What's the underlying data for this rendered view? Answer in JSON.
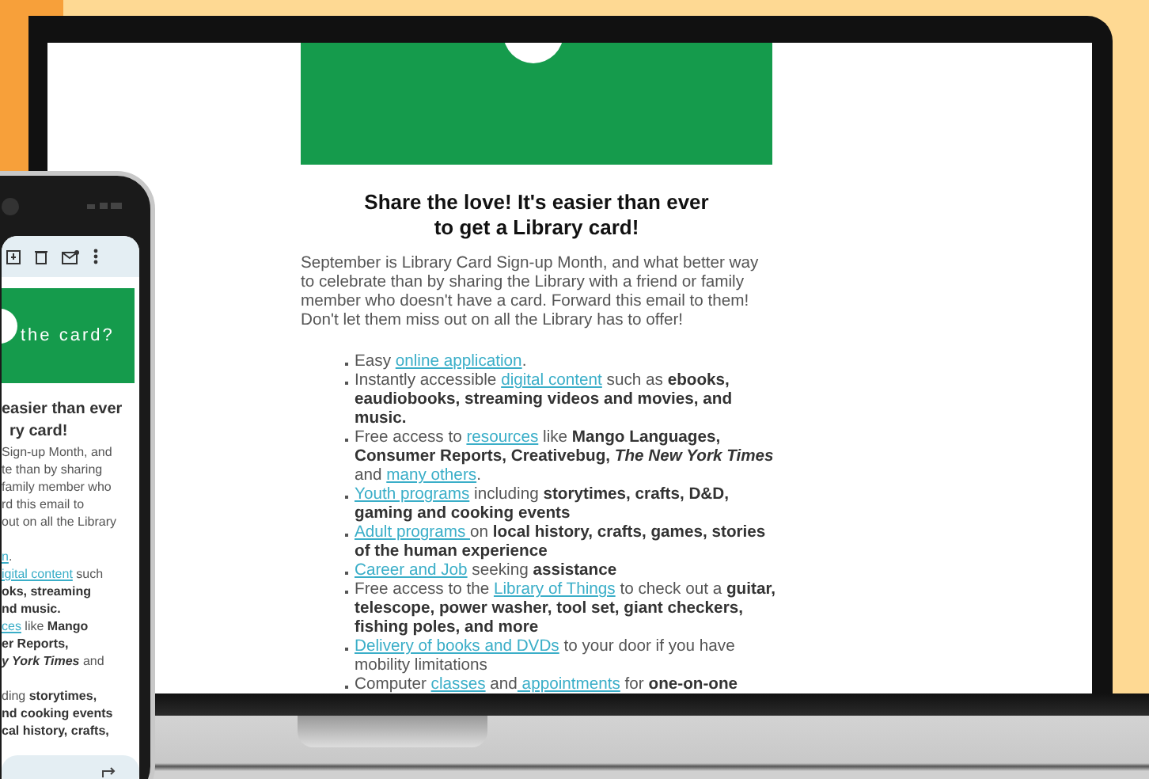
{
  "laptop": {
    "email": {
      "heading": [
        "Share the love! It's easier than ever",
        "to get a Library card!"
      ],
      "intro": "September is Library Card Sign-up Month, and what better way to celebrate than by sharing the Library with a friend or family member who doesn't have a card. Forward this email to them! Don't let them miss out on all the Library has to offer!",
      "items": [
        [
          {
            "kind": "text",
            "text": "Easy "
          },
          {
            "kind": "link",
            "text": "online application"
          },
          {
            "kind": "text",
            "text": "."
          }
        ],
        [
          {
            "kind": "text",
            "text": "Instantly accessible "
          },
          {
            "kind": "link",
            "text": "digital content"
          },
          {
            "kind": "text",
            "text": " such as "
          },
          {
            "kind": "bold",
            "text": "ebooks, eaudiobooks, streaming videos and movies, and music."
          }
        ],
        [
          {
            "kind": "text",
            "text": "Free access to "
          },
          {
            "kind": "link",
            "text": "resources"
          },
          {
            "kind": "text",
            "text": " like "
          },
          {
            "kind": "bold",
            "text": "Mango Languages, Consumer Reports, Creativebug, "
          },
          {
            "kind": "bold_italic",
            "text": "The New York Times"
          },
          {
            "kind": "text",
            "text": " and "
          },
          {
            "kind": "link",
            "text": "many others"
          },
          {
            "kind": "text",
            "text": "."
          }
        ],
        [
          {
            "kind": "link",
            "text": "Youth programs"
          },
          {
            "kind": "text",
            "text": " including "
          },
          {
            "kind": "bold",
            "text": "storytimes, crafts, D&D, gaming and cooking events"
          }
        ],
        [
          {
            "kind": "link",
            "text": "Adult programs "
          },
          {
            "kind": "text",
            "text": "on "
          },
          {
            "kind": "bold",
            "text": "local history, crafts, games, stories of the human experience"
          }
        ],
        [
          {
            "kind": "link",
            "text": "Career and Job"
          },
          {
            "kind": "text",
            "text": " seeking "
          },
          {
            "kind": "bold",
            "text": "assistance"
          }
        ],
        [
          {
            "kind": "text",
            "text": "Free access to the "
          },
          {
            "kind": "link",
            "text": "Library of Things"
          },
          {
            "kind": "text",
            "text": " to check out a "
          },
          {
            "kind": "bold",
            "text": "guitar, telescope, power washer, tool set, giant checkers, fishing poles, and more"
          }
        ],
        [
          {
            "kind": "link",
            "text": "Delivery of books and DVDs"
          },
          {
            "kind": "text",
            "text": " to your door if you have mobility limitations"
          }
        ],
        [
          {
            "kind": "text",
            "text": "Computer "
          },
          {
            "kind": "link",
            "text": "classes"
          },
          {
            "kind": "text",
            "text": " and"
          },
          {
            "kind": "link",
            "text": " appointments"
          },
          {
            "kind": "text",
            "text": " for "
          },
          {
            "kind": "bold",
            "text": "one-on-one"
          }
        ]
      ]
    }
  },
  "phone": {
    "banner_text": "the card?",
    "lines": [
      [
        {
          "kind": "heading",
          "text": "easier than ever"
        }
      ],
      [
        {
          "kind": "heading",
          "text": "ry card!"
        }
      ],
      [
        {
          "kind": "text",
          "text": "Sign-up Month, and"
        }
      ],
      [
        {
          "kind": "text",
          "text": "te than by sharing"
        }
      ],
      [
        {
          "kind": "text",
          "text": "family member who"
        }
      ],
      [
        {
          "kind": "text",
          "text": "rd this email to"
        }
      ],
      [
        {
          "kind": "text",
          "text": "out on all the Library"
        }
      ],
      [
        {
          "kind": "link",
          "text": "n",
          "gap_before": true
        },
        {
          "kind": "text",
          "text": "."
        }
      ],
      [
        {
          "kind": "link",
          "text": "igital content"
        },
        {
          "kind": "text",
          "text": " such"
        }
      ],
      [
        {
          "kind": "bold",
          "text": "oks, streaming"
        }
      ],
      [
        {
          "kind": "bold",
          "text": "nd music."
        }
      ],
      [
        {
          "kind": "link",
          "text": "ces"
        },
        {
          "kind": "text",
          "text": " like "
        },
        {
          "kind": "bold",
          "text": "Mango"
        }
      ],
      [
        {
          "kind": "bold",
          "text": "er Reports,"
        }
      ],
      [
        {
          "kind": "bold_italic",
          "text": "y York Times"
        },
        {
          "kind": "text",
          "text": " and"
        }
      ],
      [
        {
          "kind": "text",
          "text": "ding ",
          "gap_before": true
        },
        {
          "kind": "bold",
          "text": "storytimes,"
        }
      ],
      [
        {
          "kind": "bold",
          "text": "nd cooking events"
        }
      ],
      [
        {
          "kind": "bold",
          "text": "cal history, crafts,"
        }
      ]
    ]
  }
}
